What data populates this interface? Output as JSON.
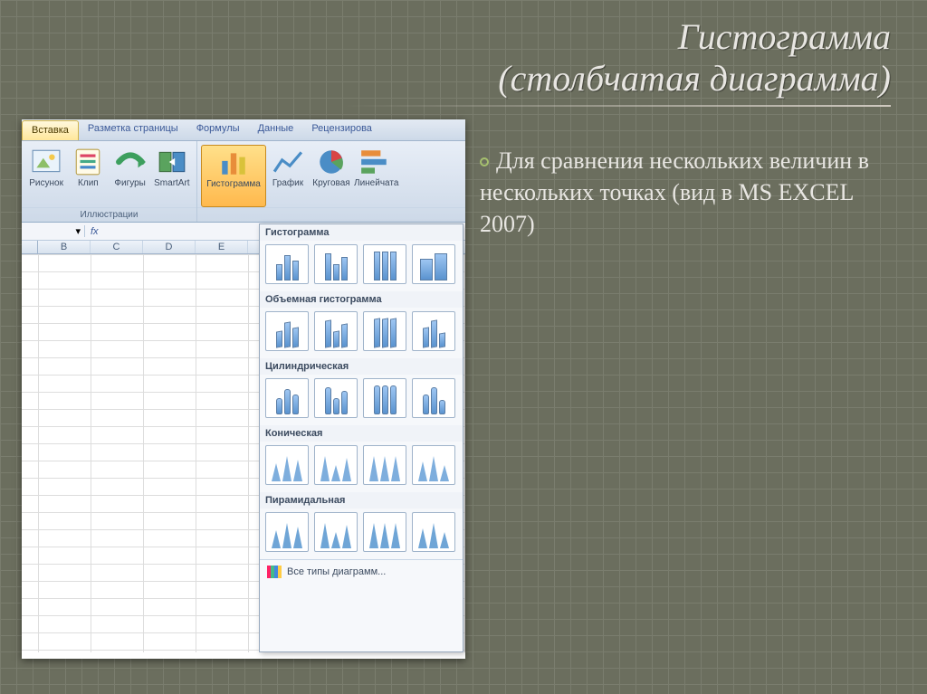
{
  "slide": {
    "title_line1": "Гистограмма",
    "title_line2": "(столбчатая диаграмма)",
    "bullet_text": "Для сравнения нескольких величин в нескольких точках (вид в MS EXCEL 2007)"
  },
  "ribbon": {
    "tabs": [
      "Вставка",
      "Разметка страницы",
      "Формулы",
      "Данные",
      "Рецензирова"
    ],
    "active_tab_index": 0,
    "group_illustrations": {
      "label": "Иллюстрации",
      "buttons": [
        "Рисунок",
        "Клип",
        "Фигуры",
        "SmartArt"
      ]
    },
    "group_charts": {
      "buttons": [
        "Гистограмма",
        "График",
        "Круговая",
        "Линейчата"
      ]
    }
  },
  "gallery": {
    "sections": [
      {
        "title": "Гистограмма",
        "count": 4,
        "variant": "flat"
      },
      {
        "title": "Объемная гистограмма",
        "count": 4,
        "variant": "d3"
      },
      {
        "title": "Цилиндрическая",
        "count": 4,
        "variant": "cylinder"
      },
      {
        "title": "Коническая",
        "count": 4,
        "variant": "cone"
      },
      {
        "title": "Пирамидальная",
        "count": 4,
        "variant": "pyramid"
      }
    ],
    "footer": "Все типы диаграмм..."
  },
  "sheet": {
    "columns": [
      "B",
      "C",
      "D",
      "E"
    ]
  }
}
